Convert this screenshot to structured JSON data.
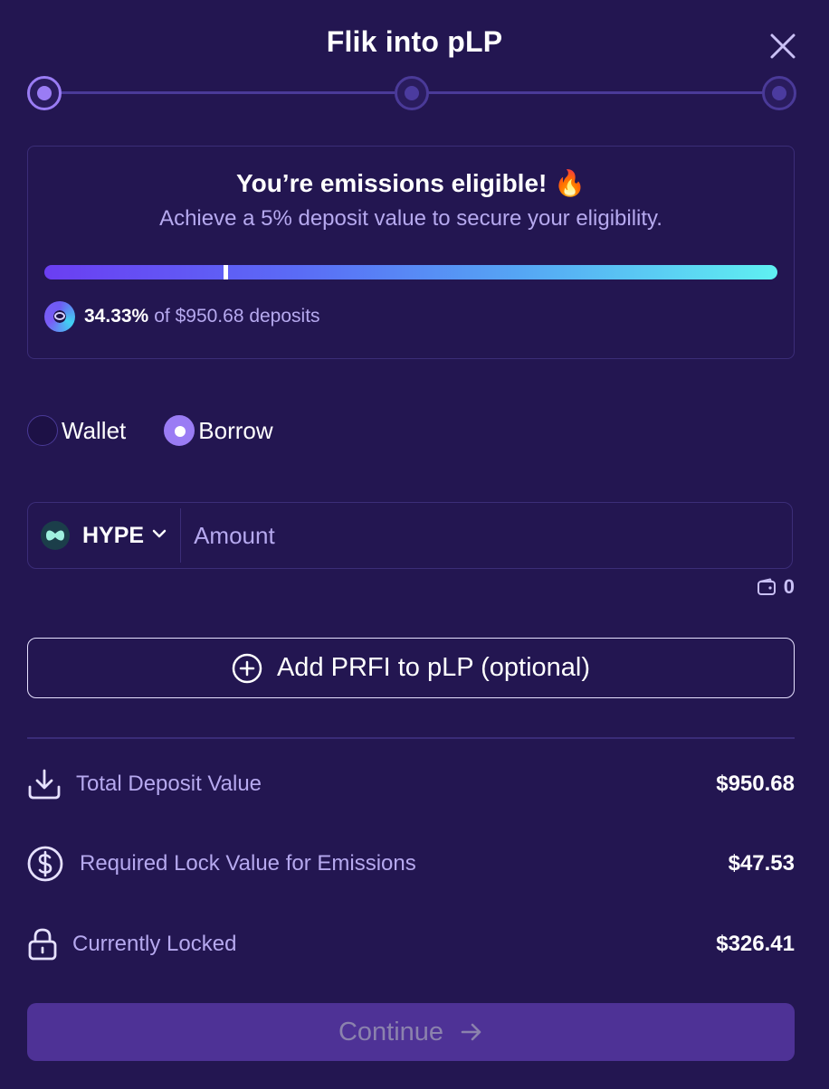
{
  "modal": {
    "title": "Flik into pLP"
  },
  "stepper": {
    "total_steps": 3,
    "current_step": 1
  },
  "eligibility": {
    "title": "You’re emissions eligible! 🔥",
    "subtitle": "Achieve a 5% deposit value to secure your eligibility.",
    "progress_fraction": 0.2475,
    "share_percent": "34.33%",
    "share_suffix": "of $950.68 deposits"
  },
  "source": {
    "options": [
      {
        "label": "Wallet",
        "selected": false
      },
      {
        "label": "Borrow",
        "selected": true
      }
    ]
  },
  "amount": {
    "token": "HYPE",
    "placeholder": "Amount",
    "value": "",
    "wallet_balance": "0"
  },
  "add_prfi": {
    "label": "Add PRFI to pLP (optional)"
  },
  "summary": {
    "total_deposit": {
      "label": "Total Deposit Value",
      "value": "$950.68"
    },
    "required_lock": {
      "label": "Required Lock Value for Emissions",
      "value": "$47.53"
    },
    "currently_locked": {
      "label": "Currently Locked",
      "value": "$326.41"
    }
  },
  "continue": {
    "label": "Continue"
  },
  "colors": {
    "background": "#231651",
    "accent": "#9a7cf4",
    "muted_text": "#b6a9ef",
    "border": "#3b2d78",
    "continue_bg": "#4e3296"
  }
}
